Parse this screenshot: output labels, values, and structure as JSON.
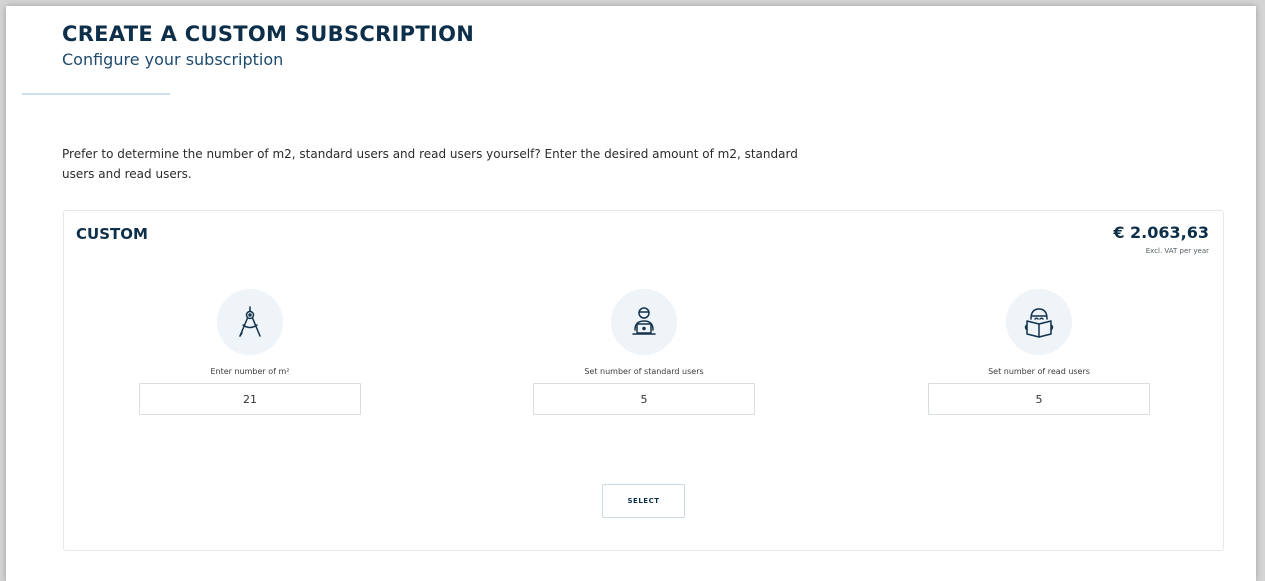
{
  "header": {
    "title": "CREATE A CUSTOM SUBSCRIPTION",
    "subtitle": "Configure your subscription"
  },
  "intro": {
    "text": "Prefer to determine the number of m2, standard users and read users yourself? Enter the desired amount of m2, standard users and read users."
  },
  "card": {
    "title": "CUSTOM",
    "price": "€ 2.063,63",
    "price_note": "Excl. VAT per year",
    "fields": [
      {
        "icon": "compass-icon",
        "label": "Enter number of m²",
        "value": "21"
      },
      {
        "icon": "user-laptop-icon",
        "label": "Set number of standard users",
        "value": "5"
      },
      {
        "icon": "reader-book-icon",
        "label": "Set number of read users",
        "value": "5"
      }
    ],
    "select_label": "SELECT"
  },
  "colors": {
    "primary_navy": "#0e2f4a",
    "icon_background": "#eef4f8",
    "icon_stroke": "#12324d"
  }
}
